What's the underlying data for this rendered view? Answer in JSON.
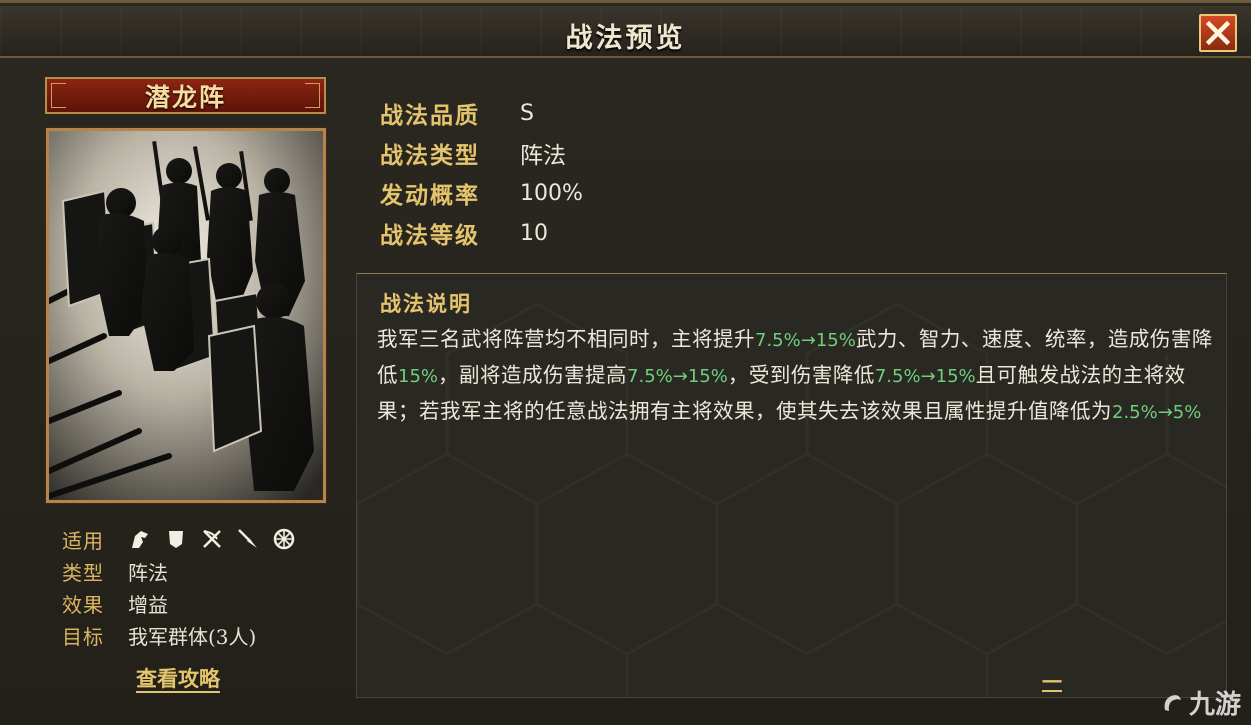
{
  "window": {
    "title": "战法预览",
    "close_icon": "close-x-icon"
  },
  "skill": {
    "name": "潜龙阵",
    "quality_label": "战法品质",
    "quality": "S",
    "type_label": "战法类型",
    "type": "阵法",
    "chance_label": "发动概率",
    "chance": "100%",
    "level_label": "战法等级",
    "level": "10"
  },
  "attributes": {
    "applicable_label": "适用",
    "applicable_troops": [
      "cavalry-icon",
      "shield-icon",
      "archer-icon",
      "spear-icon",
      "siege-icon"
    ],
    "category_label": "类型",
    "category": "阵法",
    "effect_label": "效果",
    "effect": "增益",
    "target_label": "目标",
    "target": "我军群体(3人)"
  },
  "guide_link": "查看攻略",
  "description": {
    "title": "战法说明",
    "segments": [
      {
        "t": "我军三名武将阵营均不相同时，主将提升",
        "hl": false
      },
      {
        "t": "7.5%→15%",
        "hl": true
      },
      {
        "t": "武力、智力、速度、统率，造成伤害降低",
        "hl": false
      },
      {
        "t": "15%",
        "hl": true
      },
      {
        "t": "，副将造成伤害提高",
        "hl": false
      },
      {
        "t": "7.5%→15%",
        "hl": true
      },
      {
        "t": "，受到伤害降低",
        "hl": false
      },
      {
        "t": "7.5%→15%",
        "hl": true
      },
      {
        "t": "且可触发战法的主将效果；若我军主将的任意战法拥有主将效果，使其失去该效果且属性提升值降低为",
        "hl": false
      },
      {
        "t": "2.5%→5%",
        "hl": true
      }
    ],
    "more_link": "一"
  },
  "watermark": "九游",
  "colors": {
    "highlight_green": "#6ecf7c",
    "gold_label": "#e4c46c",
    "name_banner": "#8e2413"
  }
}
